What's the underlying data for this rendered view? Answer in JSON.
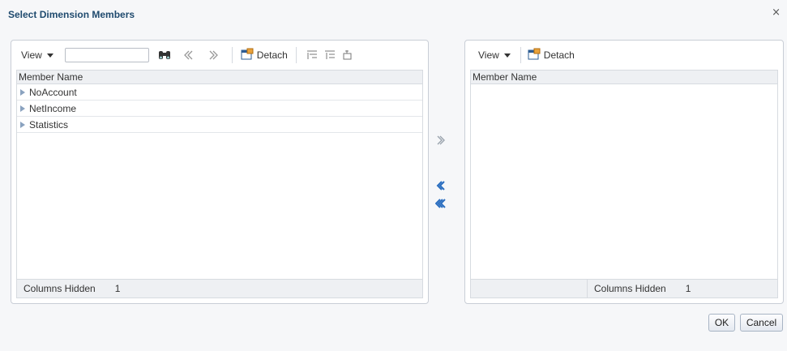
{
  "dialog": {
    "title": "Select Dimension Members",
    "close": "×"
  },
  "left_panel": {
    "view_label": "View",
    "search_value": "",
    "detach_label": "Detach",
    "column_header": "Member Name",
    "rows": [
      {
        "label": "NoAccount"
      },
      {
        "label": "NetIncome"
      },
      {
        "label": "Statistics"
      }
    ],
    "footer_label": "Columns Hidden",
    "footer_value": "1"
  },
  "right_panel": {
    "view_label": "View",
    "detach_label": "Detach",
    "column_header": "Member Name",
    "rows": [],
    "footer_label": "Columns Hidden",
    "footer_value": "1"
  },
  "buttons": {
    "ok": "OK",
    "cancel": "Cancel"
  },
  "icons": {
    "find": "binoculars-icon",
    "prev": "double-chevron-left-icon",
    "next": "double-chevron-right-icon",
    "detach": "detach-icon",
    "tree_expand": "expand-tree-icon",
    "tree_collapse": "collapse-tree-icon",
    "focus": "focus-icon",
    "move": "move-right-icon",
    "remove": "move-left-icon",
    "remove_all": "move-all-left-icon"
  },
  "colors": {
    "title": "#1f4a6e",
    "shuttle_active": "#2a6ec0",
    "shuttle_disabled": "#9aa3ad"
  }
}
